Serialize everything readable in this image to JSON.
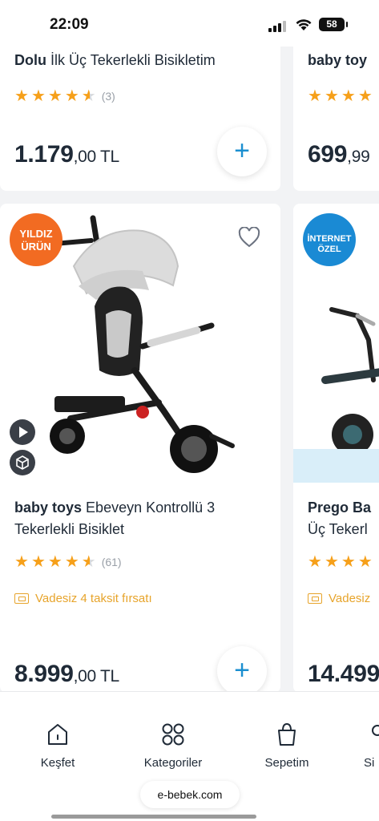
{
  "status": {
    "time": "22:09",
    "battery": "58"
  },
  "products_top": [
    {
      "brand": "Dolu",
      "name": "İlk Üç Tekerlekli Bisikletim",
      "rating": 4.5,
      "reviews": "(3)",
      "price_main": "1.179",
      "price_dec": ",00 TL"
    },
    {
      "brand": "baby toy",
      "name": "",
      "price_main": "699",
      "price_dec": ",99"
    }
  ],
  "products_bottom": [
    {
      "badge": "YILDIZ ÜRÜN",
      "brand": "baby toys",
      "name": "Ebeveyn Kontrollü 3 Tekerlekli Bisiklet",
      "rating": 4.5,
      "reviews": "(61)",
      "installment": "Vadesiz 4 taksit fırsatı",
      "price_main": "8.999",
      "price_dec": ",00 TL"
    },
    {
      "badge": "İNTERNET ÖZEL",
      "brand": "Prego Ba",
      "name": "Üç Tekerl",
      "installment": "Vadesiz",
      "price_main": "14.499",
      "price_dec": ""
    }
  ],
  "tabs": [
    {
      "label": "Keşfet",
      "icon": "home-icon"
    },
    {
      "label": "Kategoriler",
      "icon": "grid-icon"
    },
    {
      "label": "Sepetim",
      "icon": "bag-icon"
    },
    {
      "label": "Si",
      "icon": "user-icon"
    }
  ],
  "browser": {
    "url": "e-bebek.com"
  },
  "colors": {
    "accent": "#1b8fd0",
    "star": "#f6a01a",
    "badge_star": "#f26b22",
    "badge_online": "#1a8ad4",
    "installment": "#e7a42b"
  }
}
